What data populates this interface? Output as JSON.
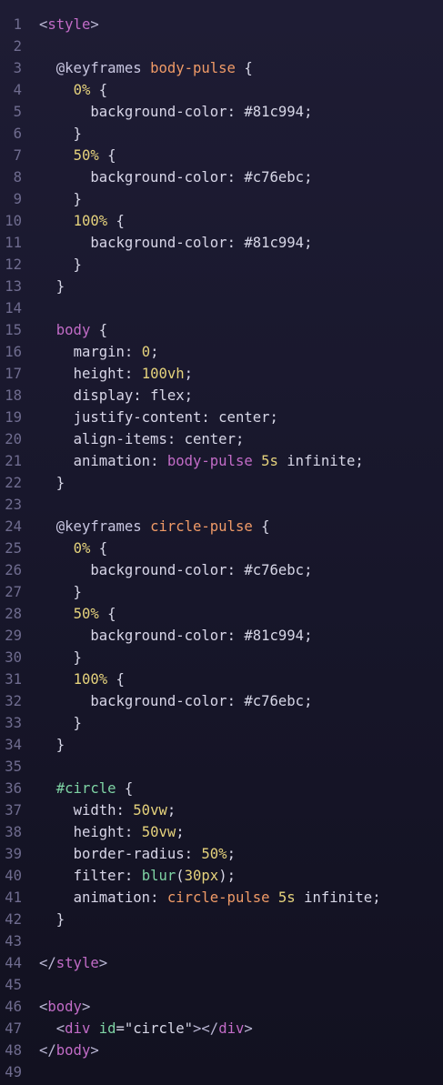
{
  "editor": {
    "language": "html",
    "lines": [
      {
        "n": "1",
        "tokens": [
          [
            "tok-punct",
            "<"
          ],
          [
            "tok-tag",
            "style"
          ],
          [
            "tok-punct",
            ">"
          ]
        ]
      },
      {
        "n": "2",
        "tokens": []
      },
      {
        "n": "3",
        "tokens": [
          [
            "tok-plain",
            "  "
          ],
          [
            "tok-kw",
            "@keyframes"
          ],
          [
            "tok-plain",
            " "
          ],
          [
            "tok-name",
            "body-pulse"
          ],
          [
            "tok-plain",
            " {"
          ]
        ]
      },
      {
        "n": "4",
        "tokens": [
          [
            "tok-plain",
            "    "
          ],
          [
            "tok-num",
            "0%"
          ],
          [
            "tok-plain",
            " {"
          ]
        ]
      },
      {
        "n": "5",
        "tokens": [
          [
            "tok-plain",
            "      "
          ],
          [
            "tok-prop",
            "background-color"
          ],
          [
            "tok-plain",
            ": "
          ],
          [
            "tok-val",
            "#81c994"
          ],
          [
            "tok-plain",
            ";"
          ]
        ]
      },
      {
        "n": "6",
        "tokens": [
          [
            "tok-plain",
            "    }"
          ]
        ]
      },
      {
        "n": "7",
        "tokens": [
          [
            "tok-plain",
            "    "
          ],
          [
            "tok-num",
            "50%"
          ],
          [
            "tok-plain",
            " {"
          ]
        ]
      },
      {
        "n": "8",
        "tokens": [
          [
            "tok-plain",
            "      "
          ],
          [
            "tok-prop",
            "background-color"
          ],
          [
            "tok-plain",
            ": "
          ],
          [
            "tok-val",
            "#c76ebc"
          ],
          [
            "tok-plain",
            ";"
          ]
        ]
      },
      {
        "n": "9",
        "tokens": [
          [
            "tok-plain",
            "    }"
          ]
        ]
      },
      {
        "n": "10",
        "tokens": [
          [
            "tok-plain",
            "    "
          ],
          [
            "tok-num",
            "100%"
          ],
          [
            "tok-plain",
            " {"
          ]
        ]
      },
      {
        "n": "11",
        "tokens": [
          [
            "tok-plain",
            "      "
          ],
          [
            "tok-prop",
            "background-color"
          ],
          [
            "tok-plain",
            ": "
          ],
          [
            "tok-val",
            "#81c994"
          ],
          [
            "tok-plain",
            ";"
          ]
        ]
      },
      {
        "n": "12",
        "tokens": [
          [
            "tok-plain",
            "    }"
          ]
        ]
      },
      {
        "n": "13",
        "tokens": [
          [
            "tok-plain",
            "  }"
          ]
        ]
      },
      {
        "n": "14",
        "tokens": []
      },
      {
        "n": "15",
        "tokens": [
          [
            "tok-plain",
            "  "
          ],
          [
            "tok-sel",
            "body"
          ],
          [
            "tok-plain",
            " {"
          ]
        ]
      },
      {
        "n": "16",
        "tokens": [
          [
            "tok-plain",
            "    "
          ],
          [
            "tok-prop",
            "margin"
          ],
          [
            "tok-plain",
            ": "
          ],
          [
            "tok-num",
            "0"
          ],
          [
            "tok-plain",
            ";"
          ]
        ]
      },
      {
        "n": "17",
        "tokens": [
          [
            "tok-plain",
            "    "
          ],
          [
            "tok-prop",
            "height"
          ],
          [
            "tok-plain",
            ": "
          ],
          [
            "tok-num",
            "100vh"
          ],
          [
            "tok-plain",
            ";"
          ]
        ]
      },
      {
        "n": "18",
        "tokens": [
          [
            "tok-plain",
            "    "
          ],
          [
            "tok-prop",
            "display"
          ],
          [
            "tok-plain",
            ": "
          ],
          [
            "tok-val",
            "flex"
          ],
          [
            "tok-plain",
            ";"
          ]
        ]
      },
      {
        "n": "19",
        "tokens": [
          [
            "tok-plain",
            "    "
          ],
          [
            "tok-prop",
            "justify-content"
          ],
          [
            "tok-plain",
            ": "
          ],
          [
            "tok-val",
            "center"
          ],
          [
            "tok-plain",
            ";"
          ]
        ]
      },
      {
        "n": "20",
        "tokens": [
          [
            "tok-plain",
            "    "
          ],
          [
            "tok-prop",
            "align-items"
          ],
          [
            "tok-plain",
            ": "
          ],
          [
            "tok-val",
            "center"
          ],
          [
            "tok-plain",
            ";"
          ]
        ]
      },
      {
        "n": "21",
        "tokens": [
          [
            "tok-plain",
            "    "
          ],
          [
            "tok-prop",
            "animation"
          ],
          [
            "tok-plain",
            ": "
          ],
          [
            "tok-sel",
            "body-pulse"
          ],
          [
            "tok-plain",
            " "
          ],
          [
            "tok-num",
            "5s"
          ],
          [
            "tok-plain",
            " "
          ],
          [
            "tok-val",
            "infinite"
          ],
          [
            "tok-plain",
            ";"
          ]
        ]
      },
      {
        "n": "22",
        "tokens": [
          [
            "tok-plain",
            "  }"
          ]
        ]
      },
      {
        "n": "23",
        "tokens": []
      },
      {
        "n": "24",
        "tokens": [
          [
            "tok-plain",
            "  "
          ],
          [
            "tok-kw",
            "@keyframes"
          ],
          [
            "tok-plain",
            " "
          ],
          [
            "tok-name",
            "circle-pulse"
          ],
          [
            "tok-plain",
            " {"
          ]
        ]
      },
      {
        "n": "25",
        "tokens": [
          [
            "tok-plain",
            "    "
          ],
          [
            "tok-num",
            "0%"
          ],
          [
            "tok-plain",
            " {"
          ]
        ]
      },
      {
        "n": "26",
        "tokens": [
          [
            "tok-plain",
            "      "
          ],
          [
            "tok-prop",
            "background-color"
          ],
          [
            "tok-plain",
            ": "
          ],
          [
            "tok-val",
            "#c76ebc"
          ],
          [
            "tok-plain",
            ";"
          ]
        ]
      },
      {
        "n": "27",
        "tokens": [
          [
            "tok-plain",
            "    }"
          ]
        ]
      },
      {
        "n": "28",
        "tokens": [
          [
            "tok-plain",
            "    "
          ],
          [
            "tok-num",
            "50%"
          ],
          [
            "tok-plain",
            " {"
          ]
        ]
      },
      {
        "n": "29",
        "tokens": [
          [
            "tok-plain",
            "      "
          ],
          [
            "tok-prop",
            "background-color"
          ],
          [
            "tok-plain",
            ": "
          ],
          [
            "tok-val",
            "#81c994"
          ],
          [
            "tok-plain",
            ";"
          ]
        ]
      },
      {
        "n": "30",
        "tokens": [
          [
            "tok-plain",
            "    }"
          ]
        ]
      },
      {
        "n": "31",
        "tokens": [
          [
            "tok-plain",
            "    "
          ],
          [
            "tok-num",
            "100%"
          ],
          [
            "tok-plain",
            " {"
          ]
        ]
      },
      {
        "n": "32",
        "tokens": [
          [
            "tok-plain",
            "      "
          ],
          [
            "tok-prop",
            "background-color"
          ],
          [
            "tok-plain",
            ": "
          ],
          [
            "tok-val",
            "#c76ebc"
          ],
          [
            "tok-plain",
            ";"
          ]
        ]
      },
      {
        "n": "33",
        "tokens": [
          [
            "tok-plain",
            "    }"
          ]
        ]
      },
      {
        "n": "34",
        "tokens": [
          [
            "tok-plain",
            "  }"
          ]
        ]
      },
      {
        "n": "35",
        "tokens": []
      },
      {
        "n": "36",
        "tokens": [
          [
            "tok-plain",
            "  "
          ],
          [
            "tok-id",
            "#circle"
          ],
          [
            "tok-plain",
            " {"
          ]
        ]
      },
      {
        "n": "37",
        "tokens": [
          [
            "tok-plain",
            "    "
          ],
          [
            "tok-prop",
            "width"
          ],
          [
            "tok-plain",
            ": "
          ],
          [
            "tok-num",
            "50vw"
          ],
          [
            "tok-plain",
            ";"
          ]
        ]
      },
      {
        "n": "38",
        "tokens": [
          [
            "tok-plain",
            "    "
          ],
          [
            "tok-prop",
            "height"
          ],
          [
            "tok-plain",
            ": "
          ],
          [
            "tok-num",
            "50vw"
          ],
          [
            "tok-plain",
            ";"
          ]
        ]
      },
      {
        "n": "39",
        "tokens": [
          [
            "tok-plain",
            "    "
          ],
          [
            "tok-prop",
            "border-radius"
          ],
          [
            "tok-plain",
            ": "
          ],
          [
            "tok-num",
            "50%"
          ],
          [
            "tok-plain",
            ";"
          ]
        ]
      },
      {
        "n": "40",
        "tokens": [
          [
            "tok-plain",
            "    "
          ],
          [
            "tok-prop",
            "filter"
          ],
          [
            "tok-plain",
            ": "
          ],
          [
            "tok-attr",
            "blur"
          ],
          [
            "tok-plain",
            "("
          ],
          [
            "tok-num",
            "30px"
          ],
          [
            "tok-plain",
            ");"
          ]
        ]
      },
      {
        "n": "41",
        "tokens": [
          [
            "tok-plain",
            "    "
          ],
          [
            "tok-prop",
            "animation"
          ],
          [
            "tok-plain",
            ": "
          ],
          [
            "tok-name",
            "circle-pulse"
          ],
          [
            "tok-plain",
            " "
          ],
          [
            "tok-num",
            "5s"
          ],
          [
            "tok-plain",
            " "
          ],
          [
            "tok-val",
            "infinite"
          ],
          [
            "tok-plain",
            ";"
          ]
        ]
      },
      {
        "n": "42",
        "tokens": [
          [
            "tok-plain",
            "  }"
          ]
        ]
      },
      {
        "n": "43",
        "tokens": []
      },
      {
        "n": "44",
        "tokens": [
          [
            "tok-punct",
            "</"
          ],
          [
            "tok-tag",
            "style"
          ],
          [
            "tok-punct",
            ">"
          ]
        ]
      },
      {
        "n": "45",
        "tokens": []
      },
      {
        "n": "46",
        "tokens": [
          [
            "tok-punct",
            "<"
          ],
          [
            "tok-tag",
            "body"
          ],
          [
            "tok-punct",
            ">"
          ]
        ]
      },
      {
        "n": "47",
        "tokens": [
          [
            "tok-plain",
            "  "
          ],
          [
            "tok-punct",
            "<"
          ],
          [
            "tok-tag",
            "div"
          ],
          [
            "tok-plain",
            " "
          ],
          [
            "tok-attr",
            "id"
          ],
          [
            "tok-plain",
            "="
          ],
          [
            "tok-str",
            "\"circle\""
          ],
          [
            "tok-punct",
            "></"
          ],
          [
            "tok-tag",
            "div"
          ],
          [
            "tok-punct",
            ">"
          ]
        ]
      },
      {
        "n": "48",
        "tokens": [
          [
            "tok-punct",
            "</"
          ],
          [
            "tok-tag",
            "body"
          ],
          [
            "tok-punct",
            ">"
          ]
        ]
      },
      {
        "n": "49",
        "tokens": []
      }
    ]
  }
}
